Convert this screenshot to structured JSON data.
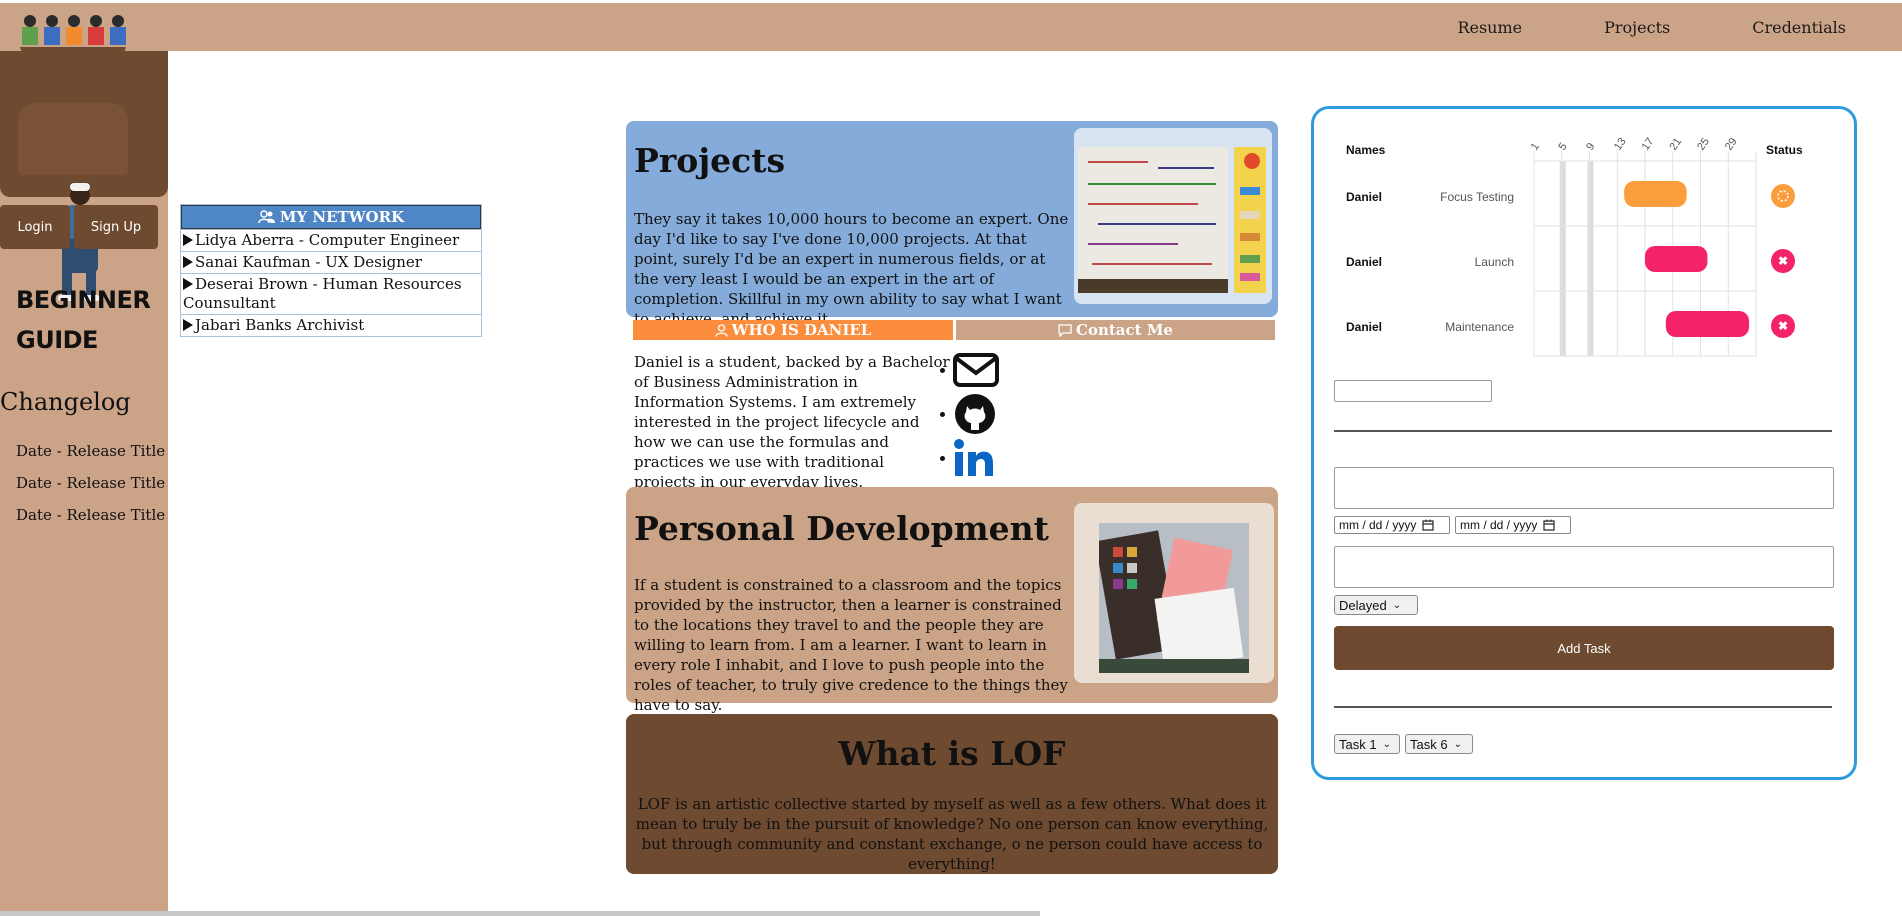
{
  "topnav": {
    "items": [
      "Resume",
      "Projects",
      "Credentials"
    ]
  },
  "sidebar": {
    "login": "Login",
    "signup": "Sign Up",
    "guide": [
      "BEGINNER",
      "GUIDE"
    ],
    "changelog_title": "Changelog",
    "changelog_items": [
      "Date - Release Title",
      "Date - Release Title",
      "Date - Release Title"
    ]
  },
  "network": {
    "title": "MY NETWORK",
    "items": [
      "Lidya Aberra - Computer Engineer",
      "Sanai Kaufman - UX Designer",
      "Deserai Brown - Human Resources Counsultant",
      "Jabari Banks Archivist"
    ]
  },
  "projects": {
    "title": "Projects",
    "text": "They say it takes 10,000 hours to become an expert. One day I'd like to say I've done 10,000 projects. At that point, surely I'd be an expert in numerous fields, or at the very least I would be an expert in the art of completion. Skillful in my own ability to say what I want to achieve, and achieve it."
  },
  "tabs": {
    "who": "WHO IS DANIEL",
    "contact": "Contact Me"
  },
  "about": {
    "text": "Daniel is a student, backed by a Bachelor of Business Administration in Information Systems. I am extremely interested in the project lifecycle and how we can use the formulas and practices we use with traditional projects in our everyday lives."
  },
  "personal_development": {
    "title": "Personal Development",
    "text": "If a student is constrained to a classroom and the topics provided by the instructor, then a learner is constrained to the locations they travel to and the people they are willing to learn from. I am a learner. I want to learn in every role I inhabit, and I love to push people into the roles of teacher, to truly give credence to the things they have to say."
  },
  "lof": {
    "title": "What is LOF",
    "text": "LOF is an artistic collective started by myself as well as a few others. What does it mean to truly be in the pursuit of knowledge? No one person can know everything, but through community and constant exchange, o ne person could have access to everything!"
  },
  "gantt": {
    "names_header": "Names",
    "status_header": "Status",
    "days": [
      "1",
      "5",
      "9",
      "13",
      "17",
      "21",
      "25",
      "29"
    ],
    "highlight_days": [
      2,
      4
    ],
    "tasks": [
      {
        "name": "Daniel",
        "task": "Focus Testing",
        "start": 14,
        "end": 23,
        "color": "#fb9d3d",
        "status": "in-progress",
        "status_color": "#fb9d3d"
      },
      {
        "name": "Daniel",
        "task": "Launch",
        "start": 17,
        "end": 26,
        "color": "#f4226b",
        "status": "delayed",
        "status_color": "#f4226b"
      },
      {
        "name": "Daniel",
        "task": "Maintenance",
        "start": 20,
        "end": 32,
        "color": "#f4226b",
        "status": "delayed",
        "status_color": "#f4226b"
      }
    ],
    "date_placeholder": "mm / dd / yyyy",
    "status_select": "Delayed",
    "add_button": "Add Task",
    "dep_select_1": "Task 1",
    "dep_select_2": "Task 6"
  },
  "icons": [
    "users-icon",
    "user-icon",
    "chat-icon",
    "envelope-icon",
    "github-icon",
    "linkedin-icon"
  ],
  "colors": {
    "tan": "#cba488",
    "brown": "#6e4a30",
    "blue": "#84abd9",
    "orange": "#fb8d3d",
    "gantt_border": "#2f9ae0"
  }
}
